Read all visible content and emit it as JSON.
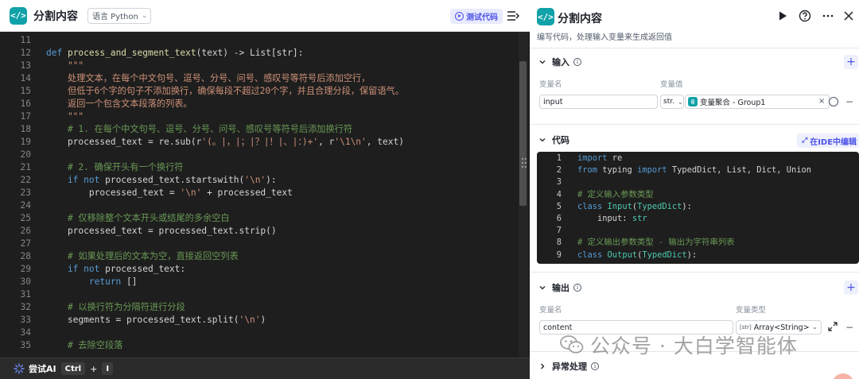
{
  "left": {
    "title": "分割内容",
    "language_select": "语言 Python",
    "test_button": "测试代码",
    "code_lines": [
      {
        "n": "11",
        "parts": []
      },
      {
        "n": "12",
        "parts": [
          [
            "kw",
            "def "
          ],
          [
            "fn",
            "process_and_segment_text"
          ],
          [
            "plain",
            "(text) -> List[str]:"
          ]
        ]
      },
      {
        "n": "13",
        "parts": [
          [
            "str",
            "    \"\"\""
          ]
        ]
      },
      {
        "n": "14",
        "parts": [
          [
            "str",
            "    处理文本，在每个中文句号、逗号、分号、问号、感叹号等符号后添加空行，"
          ]
        ]
      },
      {
        "n": "15",
        "parts": [
          [
            "str",
            "    但低于6个字的句子不添加换行，确保每段不超过20个字，并且合理分段，保留语气。"
          ]
        ]
      },
      {
        "n": "16",
        "parts": [
          [
            "str",
            "    返回一个包含文本段落的列表。"
          ]
        ]
      },
      {
        "n": "17",
        "parts": [
          [
            "str",
            "    \"\"\""
          ]
        ]
      },
      {
        "n": "18",
        "parts": [
          [
            "cm",
            "    # 1. 在每个中文句号、逗号、分号、问号、感叹号等符号后添加换行符"
          ]
        ]
      },
      {
        "n": "19",
        "parts": [
          [
            "plain",
            "    processed_text = re.sub(r"
          ],
          [
            "str",
            "'(。|，|；|？|！|、|：)+'"
          ],
          [
            "plain",
            ", r"
          ],
          [
            "str",
            "'\\1\\n'"
          ],
          [
            "plain",
            ", text)"
          ]
        ]
      },
      {
        "n": "20",
        "parts": []
      },
      {
        "n": "21",
        "parts": [
          [
            "cm",
            "    # 2. 确保开头有一个换行符"
          ]
        ]
      },
      {
        "n": "22",
        "parts": [
          [
            "kw",
            "    if not "
          ],
          [
            "plain",
            "processed_text.startswith("
          ],
          [
            "str",
            "'\\n'"
          ],
          [
            "plain",
            "):"
          ]
        ]
      },
      {
        "n": "23",
        "parts": [
          [
            "plain",
            "        processed_text = "
          ],
          [
            "str",
            "'\\n'"
          ],
          [
            "plain",
            " + processed_text"
          ]
        ]
      },
      {
        "n": "24",
        "parts": []
      },
      {
        "n": "25",
        "parts": [
          [
            "cm",
            "    # 仅移除整个文本开头或结尾的多余空白"
          ]
        ]
      },
      {
        "n": "26",
        "parts": [
          [
            "plain",
            "    processed_text = processed_text.strip()"
          ]
        ]
      },
      {
        "n": "27",
        "parts": []
      },
      {
        "n": "28",
        "parts": [
          [
            "cm",
            "    # 如果处理后的文本为空，直接返回空列表"
          ]
        ]
      },
      {
        "n": "29",
        "parts": [
          [
            "kw",
            "    if not "
          ],
          [
            "plain",
            "processed_text:"
          ]
        ]
      },
      {
        "n": "30",
        "parts": [
          [
            "kw",
            "        return "
          ],
          [
            "plain",
            "[]"
          ]
        ]
      },
      {
        "n": "31",
        "parts": []
      },
      {
        "n": "32",
        "parts": [
          [
            "cm",
            "    # 以换行符为分隔符进行分段"
          ]
        ]
      },
      {
        "n": "33",
        "parts": [
          [
            "plain",
            "    segments = processed_text.split("
          ],
          [
            "str",
            "'\\n'"
          ],
          [
            "plain",
            ")"
          ]
        ]
      },
      {
        "n": "34",
        "parts": []
      },
      {
        "n": "35",
        "parts": [
          [
            "cm",
            "    # 去除空段落"
          ]
        ]
      }
    ],
    "ai_bar": {
      "label": "尝试AI",
      "key1": "Ctrl",
      "plus": "+",
      "key2": "I"
    }
  },
  "right": {
    "title": "分割内容",
    "description": "编写代码，处理输入变量来生成返回值",
    "input_section": {
      "title": "输入",
      "col_name": "变量名",
      "col_value": "变量值",
      "row": {
        "name": "input",
        "type": "str.",
        "ref": "变量聚合 - Group1"
      }
    },
    "code_section": {
      "title": "代码",
      "ide_button": "在IDE中编辑",
      "lines": [
        {
          "n": "1",
          "parts": [
            [
              "kw",
              "import "
            ],
            [
              "plain",
              "re"
            ]
          ]
        },
        {
          "n": "2",
          "parts": [
            [
              "kw",
              "from "
            ],
            [
              "plain",
              "typing "
            ],
            [
              "kw",
              "import "
            ],
            [
              "plain",
              "TypedDict, List, Dict, Union"
            ]
          ]
        },
        {
          "n": "3",
          "parts": []
        },
        {
          "n": "4",
          "parts": [
            [
              "cm",
              "# 定义输入参数类型"
            ]
          ]
        },
        {
          "n": "5",
          "parts": [
            [
              "kw",
              "class "
            ],
            [
              "ty",
              "Input"
            ],
            [
              "plain",
              "("
            ],
            [
              "ty",
              "TypedDict"
            ],
            [
              "plain",
              "):"
            ]
          ]
        },
        {
          "n": "6",
          "parts": [
            [
              "plain",
              "    input: "
            ],
            [
              "ty",
              "str"
            ]
          ]
        },
        {
          "n": "7",
          "parts": []
        },
        {
          "n": "8",
          "parts": [
            [
              "cm",
              "# 定义输出参数类型 - 输出为字符串列表"
            ]
          ]
        },
        {
          "n": "9",
          "parts": [
            [
              "kw",
              "class "
            ],
            [
              "ty",
              "Output"
            ],
            [
              "plain",
              "("
            ],
            [
              "ty",
              "TypedDict"
            ],
            [
              "plain",
              "):"
            ]
          ]
        }
      ]
    },
    "output_section": {
      "title": "输出",
      "col_name": "变量名",
      "col_type": "变量类型",
      "row": {
        "name": "content",
        "type": "Array<String>",
        "type_icon": "[str]"
      }
    },
    "error_section": {
      "title": "异常处理"
    }
  },
  "watermark": "公众号 · 大白学智能体",
  "colors": {
    "accent": "#4d53e8",
    "brand": "#11a1a8",
    "editor_bg": "#1e1e1e"
  }
}
